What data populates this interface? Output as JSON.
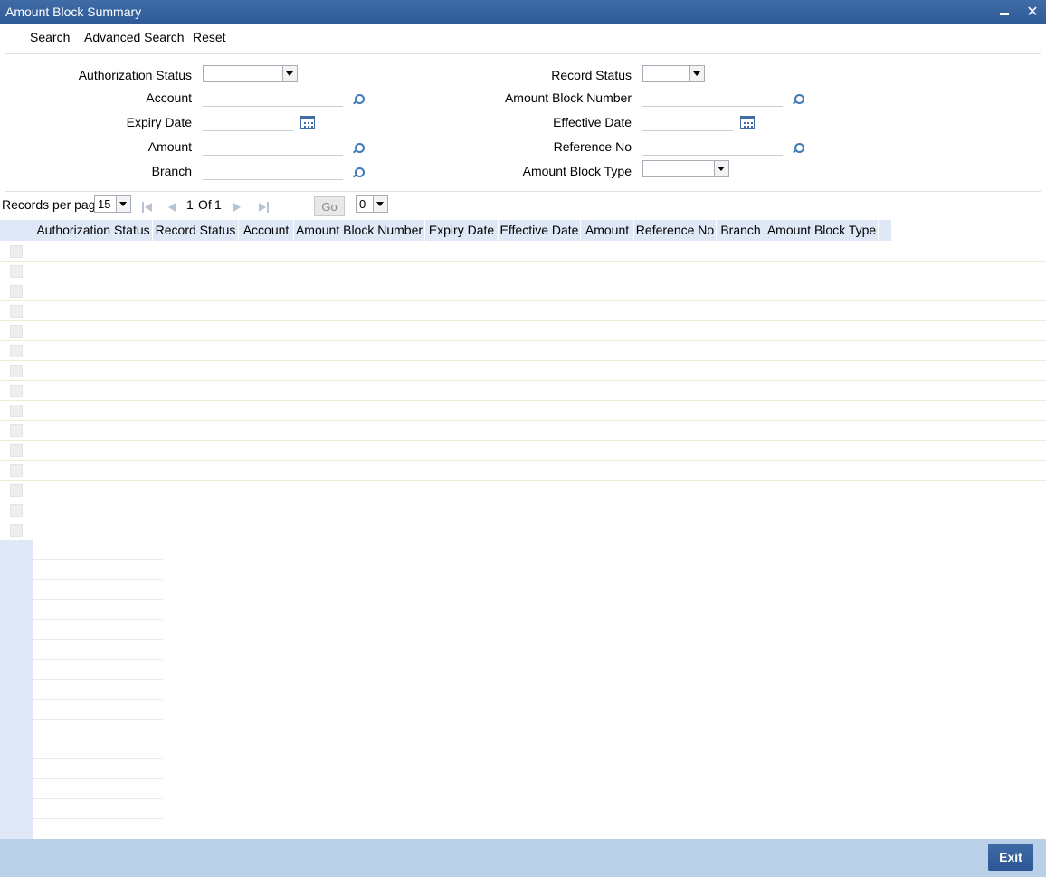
{
  "window": {
    "title": "Amount Block Summary"
  },
  "menu": {
    "search": "Search",
    "advanced_search": "Advanced Search",
    "reset": "Reset"
  },
  "form": {
    "authorization_status": "Authorization Status",
    "account": "Account",
    "expiry_date": "Expiry Date",
    "amount": "Amount",
    "branch": "Branch",
    "record_status": "Record Status",
    "amount_block_number": "Amount Block Number",
    "effective_date": "Effective Date",
    "reference_no": "Reference No",
    "amount_block_type": "Amount Block Type"
  },
  "pager": {
    "records_per_page_label": "Records per page",
    "records_per_page_value": "15",
    "page_current": "1",
    "page_of": "Of",
    "page_total": "1",
    "go_label": "Go",
    "jump_value": "0"
  },
  "grid": {
    "columns": [
      "Authorization Status",
      "Record Status",
      "Account",
      "Amount Block Number",
      "Expiry Date",
      "Effective Date",
      "Amount",
      "Reference No",
      "Branch",
      "Amount Block Type"
    ]
  },
  "footer": {
    "exit_label": "Exit"
  },
  "colors": {
    "titlebar": "#2e5a98",
    "header": "#dfe8f6",
    "footer": "#b9d0e8"
  }
}
